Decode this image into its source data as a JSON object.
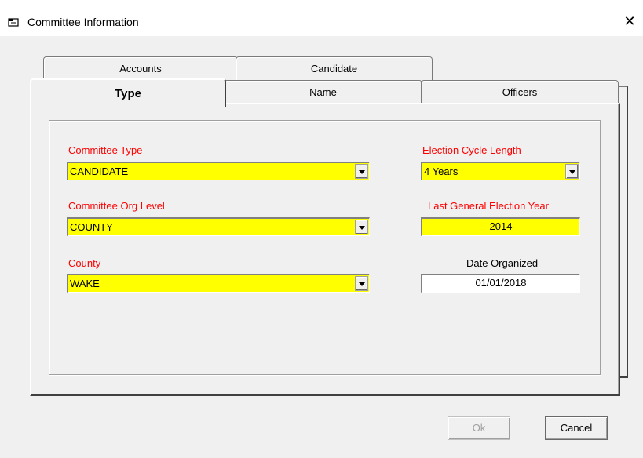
{
  "window": {
    "title": "Committee Information",
    "close_glyph": "✕"
  },
  "tabs": {
    "back_row": [
      {
        "label": "Accounts"
      },
      {
        "label": "Candidate"
      }
    ],
    "front_row": [
      {
        "label": "Type",
        "active": true
      },
      {
        "label": "Name"
      },
      {
        "label": "Officers"
      }
    ]
  },
  "form": {
    "committee_type": {
      "label": "Committee Type",
      "value": "CANDIDATE"
    },
    "committee_org_level": {
      "label": "Committee Org Level",
      "value": "COUNTY"
    },
    "county": {
      "label": "County",
      "value": "WAKE"
    },
    "election_cycle_length": {
      "label": "Election Cycle Length",
      "value": "4 Years"
    },
    "last_general_election_year": {
      "label": "Last General Election Year",
      "value": "2014"
    },
    "date_organized": {
      "label": "Date Organized",
      "value": "01/01/2018"
    }
  },
  "buttons": {
    "ok": "Ok",
    "cancel": "Cancel"
  },
  "colors": {
    "required_label": "#ff0000",
    "required_field_bg": "#ffff00"
  },
  "icons": {
    "window_icon": "folder-window-icon",
    "close": "close-icon",
    "dropdown": "chevron-down-icon"
  }
}
